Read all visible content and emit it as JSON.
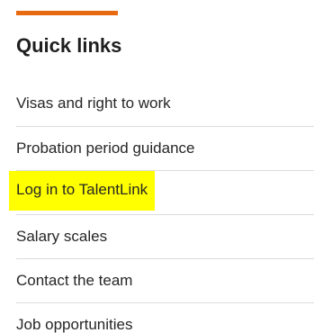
{
  "colors": {
    "accent": "#e86a10",
    "highlight": "#ffff00"
  },
  "heading": "Quick links",
  "links": [
    {
      "label": "Visas and right to work",
      "highlighted": false
    },
    {
      "label": "Probation period guidance",
      "highlighted": false
    },
    {
      "label": "Log in to TalentLink",
      "highlighted": true
    },
    {
      "label": "Salary scales",
      "highlighted": false
    },
    {
      "label": "Contact the team",
      "highlighted": false
    },
    {
      "label": "Job opportunities",
      "highlighted": false
    }
  ]
}
